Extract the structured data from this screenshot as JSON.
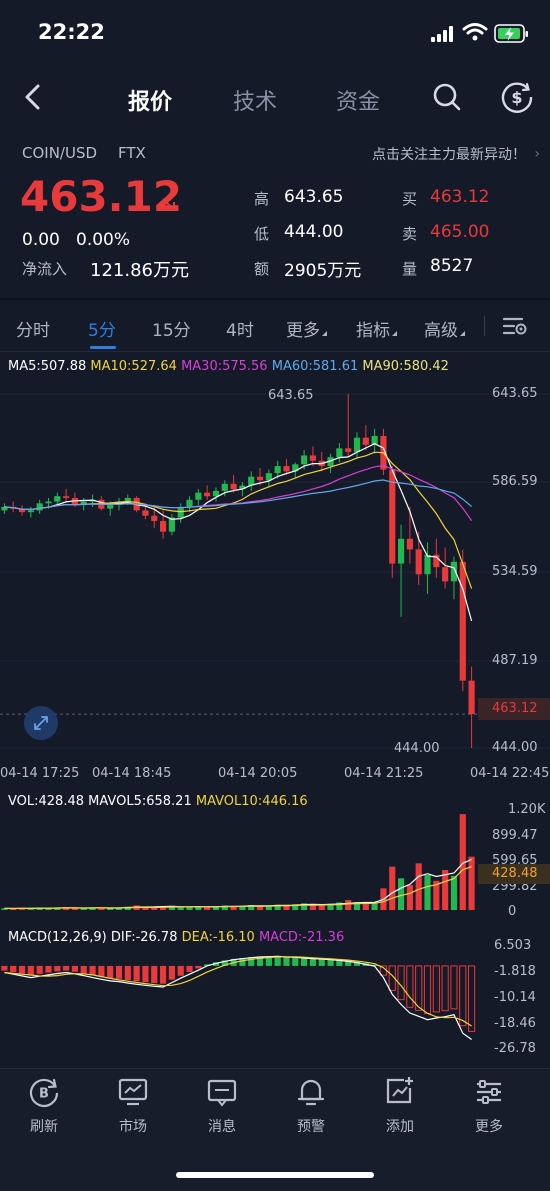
{
  "status_bar": {
    "time": "22:22"
  },
  "nav": {
    "tabs": [
      "报价",
      "技术",
      "资金"
    ],
    "active_tab": "报价"
  },
  "instrument": {
    "pair": "COIN/USD",
    "exchange": "FTX",
    "focus_prompt": "点击关注主力最新异动！",
    "price": "463.12",
    "change": "0.00",
    "change_pct": "0.00%",
    "net_inflow_label": "净流入",
    "net_inflow": "121.86万元"
  },
  "quote": {
    "high_label": "高",
    "high": "643.65",
    "low_label": "低",
    "low": "444.00",
    "amount_label": "额",
    "amount": "2905万元",
    "buy_label": "买",
    "buy": "463.12",
    "sell_label": "卖",
    "sell": "465.00",
    "volume_label": "量",
    "volume": "8527"
  },
  "periods": [
    "分时",
    "5分",
    "15分",
    "4时",
    "更多",
    "指标",
    "高级"
  ],
  "active_period": "5分",
  "ma_legend": {
    "ma5": "MA5:507.88",
    "ma10": "MA10:527.64",
    "ma30": "MA30:575.56",
    "ma60": "MA60:581.61",
    "ma90": "MA90:580.42"
  },
  "colors": {
    "up": "#20b84f",
    "down": "#e8393b",
    "ma5": "#ffffff",
    "ma10": "#f2d23c",
    "ma30": "#d63fd6",
    "ma60": "#5fa8e8",
    "ma90": "#f2d23c",
    "accent": "#2f7fe0"
  },
  "vol_legend": {
    "vol": "VOL:428.48",
    "mavol5": "MAVOL5:658.21",
    "mavol10": "MAVOL10:446.16"
  },
  "macd_legend": {
    "name": "MACD(12,26,9)",
    "dif": "DIF:-26.78",
    "dea": "DEA:-16.10",
    "macd": "MACD:-21.36"
  },
  "chart_data": [
    {
      "type": "candlestick",
      "title": "COIN/USD 5分",
      "y_ticks": [
        "643.65",
        "586.59",
        "534.59",
        "487.19",
        "444.00"
      ],
      "x_ticks": [
        "04-14 17:25",
        "04-14 18:45",
        "04-14 20:05",
        "04-14 21:25",
        "04-14 22:45"
      ],
      "ylim": [
        444.0,
        643.65
      ],
      "high_marker": "643.65",
      "low_marker": "444.00",
      "current_price": "463.12",
      "ohlc": [
        [
          578,
          582,
          576,
          580
        ],
        [
          580,
          583,
          577,
          579
        ],
        [
          579,
          581,
          575,
          577
        ],
        [
          577,
          580,
          574,
          578
        ],
        [
          578,
          584,
          576,
          582
        ],
        [
          582,
          585,
          579,
          583
        ],
        [
          583,
          588,
          581,
          586
        ],
        [
          586,
          590,
          583,
          585
        ],
        [
          585,
          588,
          580,
          581
        ],
        [
          581,
          585,
          578,
          583
        ],
        [
          583,
          587,
          580,
          584
        ],
        [
          584,
          586,
          578,
          579
        ],
        [
          579,
          583,
          575,
          581
        ],
        [
          581,
          585,
          578,
          583
        ],
        [
          583,
          587,
          581,
          585
        ],
        [
          585,
          586,
          577,
          578
        ],
        [
          578,
          582,
          573,
          575
        ],
        [
          575,
          580,
          568,
          572
        ],
        [
          572,
          578,
          562,
          566
        ],
        [
          566,
          576,
          564,
          574
        ],
        [
          574,
          582,
          571,
          580
        ],
        [
          580,
          586,
          577,
          584
        ],
        [
          584,
          590,
          581,
          588
        ],
        [
          588,
          592,
          584,
          586
        ],
        [
          586,
          591,
          583,
          589
        ],
        [
          589,
          595,
          586,
          593
        ],
        [
          593,
          598,
          588,
          590
        ],
        [
          590,
          594,
          586,
          592
        ],
        [
          592,
          600,
          589,
          597
        ],
        [
          597,
          602,
          592,
          595
        ],
        [
          595,
          601,
          591,
          599
        ],
        [
          599,
          606,
          596,
          603
        ],
        [
          603,
          607,
          598,
          600
        ],
        [
          600,
          605,
          596,
          604
        ],
        [
          604,
          612,
          601,
          609
        ],
        [
          609,
          614,
          603,
          606
        ],
        [
          606,
          611,
          600,
          603
        ],
        [
          603,
          610,
          599,
          608
        ],
        [
          608,
          616,
          605,
          613
        ],
        [
          613,
          643.65,
          608,
          611
        ],
        [
          611,
          622,
          607,
          619
        ],
        [
          619,
          626,
          612,
          615
        ],
        [
          615,
          624,
          610,
          620
        ],
        [
          620,
          624,
          598,
          601
        ],
        [
          601,
          603,
          540,
          548
        ],
        [
          548,
          570,
          518,
          562
        ],
        [
          562,
          580,
          548,
          556
        ],
        [
          556,
          566,
          536,
          542
        ],
        [
          542,
          560,
          531,
          553
        ],
        [
          553,
          562,
          540,
          546
        ],
        [
          546,
          557,
          534,
          538
        ],
        [
          538,
          552,
          528,
          549
        ],
        [
          549,
          556,
          476,
          482
        ],
        [
          482,
          490,
          444,
          463.12
        ]
      ]
    },
    {
      "type": "bar",
      "title": "VOL",
      "y_ticks": [
        "1.20K",
        "899.47",
        "599.65",
        "299.82",
        "0"
      ],
      "current": "428.48",
      "ylim": [
        0,
        1200
      ],
      "values": [
        20,
        15,
        25,
        18,
        30,
        22,
        28,
        35,
        20,
        18,
        25,
        30,
        22,
        28,
        40,
        55,
        35,
        30,
        45,
        50,
        38,
        30,
        42,
        35,
        48,
        55,
        40,
        50,
        60,
        45,
        52,
        65,
        58,
        70,
        80,
        62,
        55,
        75,
        90,
        120,
        95,
        70,
        85,
        260,
        520,
        380,
        300,
        560,
        420,
        350,
        480,
        410,
        1150,
        640
      ]
    },
    {
      "type": "bar",
      "title": "MACD(12,26,9)",
      "y_ticks": [
        "6.503",
        "-1.818",
        "-10.14",
        "-18.46",
        "-26.78"
      ],
      "ylim": [
        -26.78,
        6.503
      ],
      "values": [
        -1.5,
        -2,
        -2.5,
        -3,
        -2.6,
        -2.2,
        -1.8,
        -1.5,
        -1.9,
        -2.4,
        -3,
        -3.5,
        -4,
        -4.2,
        -4.6,
        -5,
        -5.3,
        -5.6,
        -5.8,
        -4.5,
        -3.2,
        -2,
        -0.8,
        0.5,
        1.2,
        1.8,
        2.3,
        2.6,
        2.9,
        3.1,
        3.2,
        3.3,
        3.1,
        3,
        2.8,
        2.6,
        2.5,
        2.3,
        2.1,
        1.8,
        1.4,
        0.9,
        0.4,
        -3,
        -8,
        -11,
        -13.5,
        -14.5,
        -15.5,
        -15,
        -14.6,
        -14,
        -19.5,
        -21.36
      ]
    }
  ],
  "bottom_nav": [
    {
      "label": "刷新",
      "icon": "refresh-b-icon"
    },
    {
      "label": "市场",
      "icon": "market-chart-icon"
    },
    {
      "label": "消息",
      "icon": "message-icon"
    },
    {
      "label": "预警",
      "icon": "bell-icon"
    },
    {
      "label": "添加",
      "icon": "add-chart-icon"
    },
    {
      "label": "更多",
      "icon": "more-sliders-icon"
    }
  ]
}
